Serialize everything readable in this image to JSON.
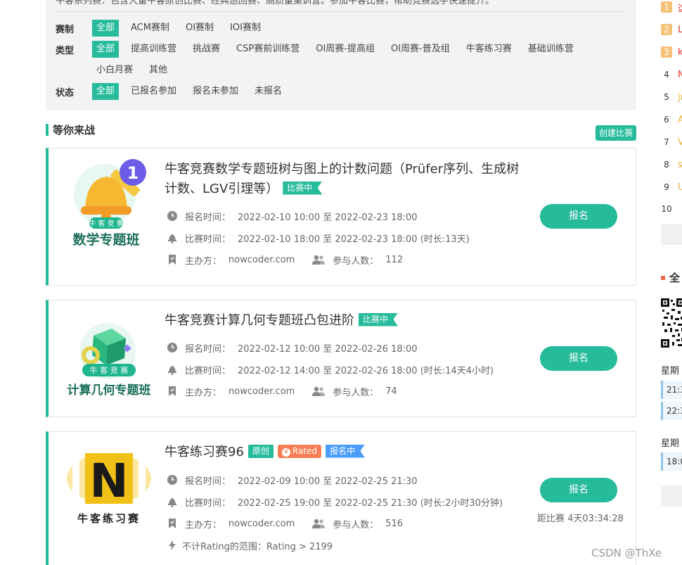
{
  "filters": {
    "intro": "牛客系列赛：包含大量牛客原创比赛、经典巡回赛、高质量集训营。参加牛客比赛，帮助竞赛选手快速提升。",
    "rows": [
      {
        "label": "赛制",
        "options": [
          "全部",
          "ACM赛制",
          "OI赛制",
          "IOI赛制"
        ]
      },
      {
        "label": "类型",
        "options": [
          "全部",
          "提高训练营",
          "挑战赛",
          "CSP赛前训练营",
          "OI周赛-提高组",
          "OI周赛-普及组",
          "牛客练习赛",
          "基础训练营"
        ]
      },
      {
        "label": "",
        "options": [
          "小白月赛",
          "其他"
        ]
      },
      {
        "label": "状态",
        "options": [
          "全部",
          "已报名参加",
          "报名未参加",
          "未报名"
        ]
      }
    ]
  },
  "section": {
    "title": "等你来战",
    "create_label": "创建比赛"
  },
  "contests": [
    {
      "title": "牛客竞赛数学专题班树与图上的计数问题（Prüfer序列、生成树计数、LGV引理等）",
      "tags": [
        {
          "text": "比赛中",
          "kind": "live"
        }
      ],
      "logo_top": "牛 客 竞 赛",
      "logo_bottom": "数学专题班",
      "logo_badge": "1",
      "signup_label": "报名时间：",
      "signup_time": "2022-02-10 10:00 至 2022-02-23 18:00",
      "contest_label": "比赛时间：",
      "contest_time": "2022-02-10 18:00 至 2022-02-23 18:00 (时长:13天)",
      "host_label": "主办方：",
      "host": "nowcoder.com",
      "participants_label": "参与人数：",
      "participants": "112",
      "button": "报名"
    },
    {
      "title": "牛客竞赛计算几何专题班凸包进阶",
      "tags": [
        {
          "text": "比赛中",
          "kind": "live"
        }
      ],
      "logo_top": "牛 客 竞 赛",
      "logo_bottom": "计算几何专题班",
      "signup_label": "报名时间：",
      "signup_time": "2022-02-12 10:00 至 2022-02-26 18:00",
      "contest_label": "比赛时间：",
      "contest_time": "2022-02-12 14:00 至 2022-02-26 18:00 (时长:14天4小时)",
      "host_label": "主办方：",
      "host": "nowcoder.com",
      "participants_label": "参与人数：",
      "participants": "74",
      "button": "报名"
    },
    {
      "title": "牛客练习赛96",
      "tags": [
        {
          "text": "原创",
          "kind": "orig"
        },
        {
          "text": "Rated",
          "kind": "rated"
        },
        {
          "text": "报名中",
          "kind": "signing"
        }
      ],
      "logo_letter": "N",
      "logo_bottom": "牛客练习赛",
      "signup_label": "报名时间：",
      "signup_time": "2022-02-09 10:00 至 2022-02-25 21:30",
      "contest_label": "比赛时间：",
      "contest_time": "2022-02-25 19:00 至 2022-02-25 21:30 (时长:2小时30分钟)",
      "host_label": "主办方：",
      "host": "nowcoder.com",
      "participants_label": "参与人数：",
      "participants": "516",
      "rating_text": "不计Rating的范围：Rating > 2199",
      "button": "报名",
      "countdown": "距比赛 4天03:34:28"
    }
  ],
  "sidebar": {
    "ranks": [
      {
        "num": "1",
        "name": "这",
        "color": "#e0302a"
      },
      {
        "num": "2",
        "name": "L",
        "color": "#e0302a"
      },
      {
        "num": "3",
        "name": "k",
        "color": "#e0302a"
      },
      {
        "num": "4",
        "name": "N",
        "color": "#e0302a"
      },
      {
        "num": "5",
        "name": "jı",
        "color": "#e8b03c"
      },
      {
        "num": "6",
        "name": "A",
        "color": "#e8b03c"
      },
      {
        "num": "7",
        "name": "V",
        "color": "#e8b03c"
      },
      {
        "num": "8",
        "name": "s",
        "color": "#e8b03c"
      },
      {
        "num": "9",
        "name": "U",
        "color": "#e8b03c"
      },
      {
        "num": "10",
        "name": "",
        "color": "#333333"
      }
    ],
    "title": "全",
    "weekday1": "星期",
    "times1": [
      "21:3",
      "22:3"
    ],
    "weekday2": "星期",
    "times2": [
      "18:0"
    ]
  },
  "watermark": "CSDN @ThXe",
  "colors": {
    "accent": "#25bb9b",
    "rated": "#f67e54",
    "signing": "#4a9df8"
  }
}
